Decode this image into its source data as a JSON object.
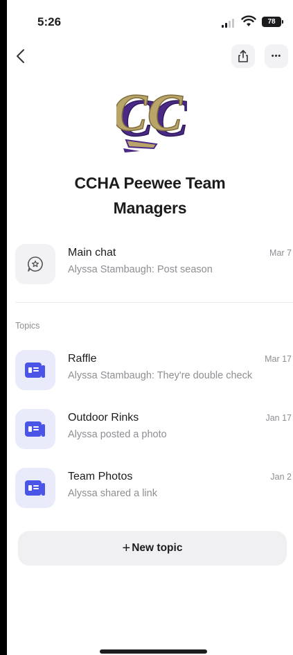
{
  "status_bar": {
    "time": "5:26",
    "battery": "78"
  },
  "header": {
    "back_icon": "chevron-left-icon",
    "share_icon": "share-icon",
    "more_icon": "ellipsis-icon",
    "more_glyph": "•••"
  },
  "group": {
    "title_line1": "CCHA Peewee Team",
    "title_line2": "Managers",
    "logo_letters": "CC",
    "colors": {
      "gold": "#b9a46a",
      "purple": "#4b2a86"
    }
  },
  "main_chat": {
    "name": "Main chat",
    "preview": "Alyssa Stambaugh: Post season",
    "date": "Mar 7",
    "icon": "chat-bubble-icon"
  },
  "topics_label": "Topics",
  "topics": [
    {
      "name": "Raffle",
      "preview": "Alyssa Stambaugh: They're double check",
      "date": "Mar 17",
      "icon": "topic-icon"
    },
    {
      "name": "Outdoor Rinks",
      "preview": "Alyssa posted a photo",
      "date": "Jan 17",
      "icon": "topic-icon"
    },
    {
      "name": "Team Photos",
      "preview": "Alyssa shared a link",
      "date": "Jan 2",
      "icon": "topic-icon"
    }
  ],
  "new_topic": {
    "plus": "+",
    "label": "New topic"
  },
  "accent": "#4a55e8"
}
